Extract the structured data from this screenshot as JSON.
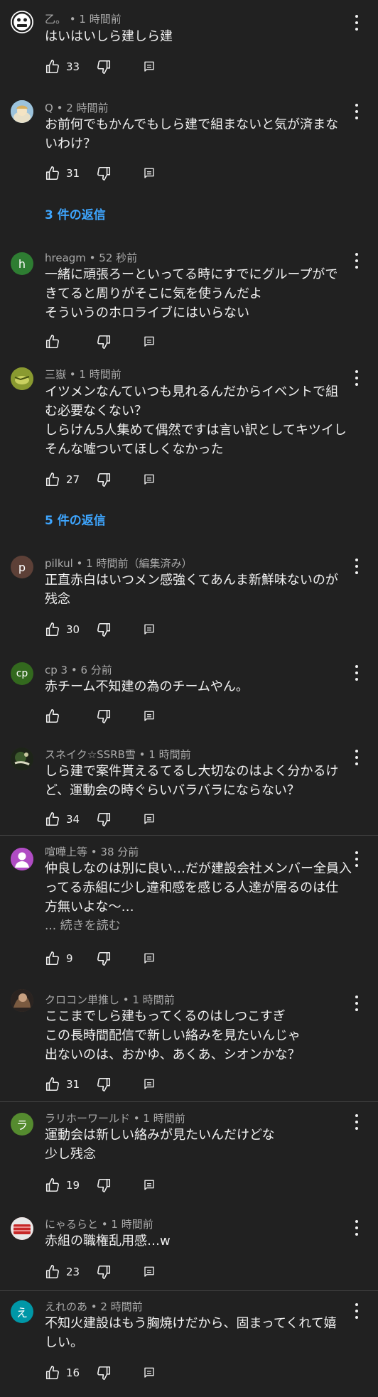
{
  "comments": [
    {
      "author": "乙。",
      "time": "1 時間前",
      "lines": [
        "はいはいしら建しら建"
      ],
      "likes": "33",
      "avatar_letter": "",
      "avatar_color": "#ffffff"
    },
    {
      "author": "Q",
      "time": "2 時間前",
      "lines": [
        "お前何でもかんでもしら建で組まないと気が済まな",
        "いわけ？"
      ],
      "likes": "31",
      "avatar_letter": "",
      "avatar_color": "#8fb7d1",
      "replies": "3 件の返信"
    },
    {
      "author": "hreagm",
      "time": "52 秒前",
      "lines": [
        "一緒に頑張ろーといってる時にすでにグループがで",
        "きてると周りがそこに気を使うんだよ",
        "そういうのホロライブにはいらない"
      ],
      "likes": "",
      "avatar_letter": "h",
      "avatar_color": "#2e7d32"
    },
    {
      "author": "三嶽",
      "time": "1 時間前",
      "lines": [
        "イツメンなんていつも見れるんだからイベントで組",
        "む必要なくない？",
        "しらけん5人集めて偶然ですは言い訳としてキツイし",
        "そんな嘘ついてほしくなかった"
      ],
      "likes": "27",
      "avatar_letter": "",
      "avatar_color": "#7c8b2f",
      "replies": "5 件の返信"
    },
    {
      "author": "pilkul",
      "time": "1 時間前（編集済み）",
      "lines": [
        "正直赤白はいつメン感強くてあんま新鮮味ないのが",
        "残念"
      ],
      "likes": "30",
      "avatar_letter": "p",
      "avatar_color": "#5d4037"
    },
    {
      "author": "cp 3",
      "time": "6 分前",
      "lines": [
        "赤チーム不知建の為のチームやん。"
      ],
      "likes": "",
      "avatar_letter": "cp",
      "avatar_color": "#33691e"
    },
    {
      "author": "スネイク☆SSRB雪",
      "time": "1 時間前",
      "lines": [
        "しら建で案件貰えるてるし大切なのはよく分かるけ",
        "ど、運動会の時ぐらいバラバラにならない？"
      ],
      "likes": "34",
      "avatar_letter": "",
      "avatar_color": "#2f3a22"
    },
    {
      "author": "喧嘩上等",
      "time": "38 分前",
      "lines": [
        "仲良しなのは別に良い…だが建設会社メンバー全員入",
        "ってる赤組に少し違和感を感じる人達が居るのは仕",
        "方無いよな～…"
      ],
      "read_more": "... 続きを読む",
      "likes": "9",
      "avatar_letter": "",
      "avatar_color": "#ab47bc"
    },
    {
      "author": "クロコン単推し",
      "time": "1 時間前",
      "lines": [
        "ここまでしら建もってくるのはしつこすぎ",
        "この長時間配信で新しい絡みを見たいんじゃ",
        "出ないのは、おかゆ、あくあ、シオンかな？"
      ],
      "likes": "31",
      "avatar_letter": "",
      "avatar_color": "#5a4a3a"
    },
    {
      "author": "ラリホーワールド",
      "time": "1 時間前",
      "lines": [
        "運動会は新しい絡みが見たいんだけどな",
        "少し残念"
      ],
      "likes": "19",
      "avatar_letter": "ラ",
      "avatar_color": "#558b2f"
    },
    {
      "author": "にゃるらと",
      "time": "1 時間前",
      "lines": [
        "赤組の職権乱用感…w"
      ],
      "likes": "23",
      "avatar_letter": "",
      "avatar_color": "#c62828"
    },
    {
      "author": "えれのあ",
      "time": "2 時間前",
      "lines": [
        "不知火建設はもう胸焼けだから、固まってくれて嬉",
        "しい。"
      ],
      "likes": "16",
      "avatar_letter": "え",
      "avatar_color": "#0097a7"
    }
  ]
}
